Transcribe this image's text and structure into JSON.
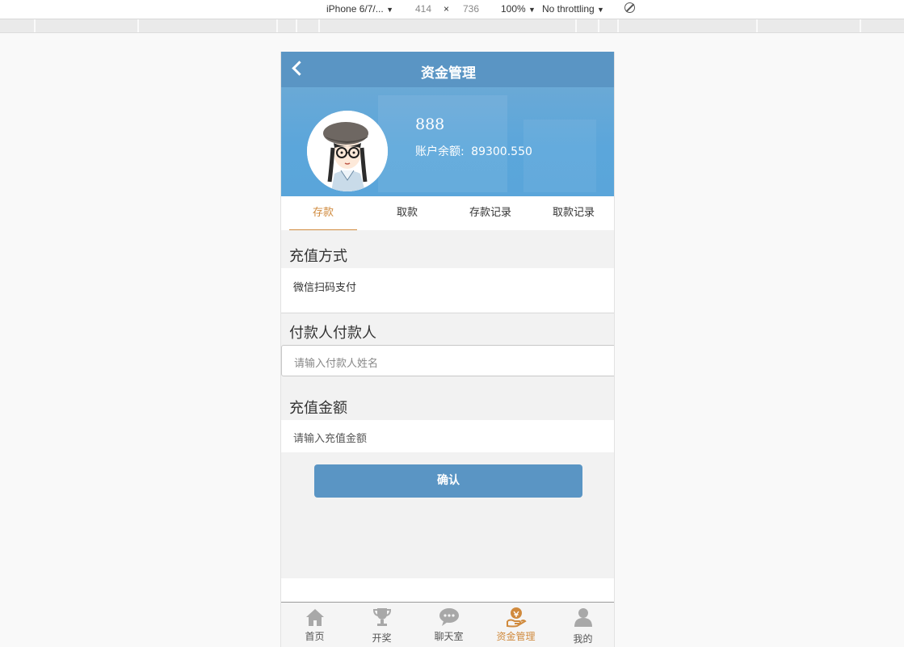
{
  "devtools": {
    "device": "iPhone 6/7/...",
    "width": "414",
    "times": "×",
    "height": "736",
    "zoom": "100%",
    "throttling": "No throttling"
  },
  "nav": {
    "title": "资金管理"
  },
  "profile": {
    "username": "888",
    "balance_label": "账户余额:",
    "balance_value": "89300.550"
  },
  "tabs": [
    {
      "label": "存款",
      "active": true
    },
    {
      "label": "取款",
      "active": false
    },
    {
      "label": "存款记录",
      "active": false
    },
    {
      "label": "取款记录",
      "active": false
    }
  ],
  "form": {
    "method_label": "充值方式",
    "method_value": "微信扫码支付",
    "payer_label": "付款人付款人",
    "payer_placeholder": "请输入付款人姓名",
    "amount_label": "充值金额",
    "amount_placeholder": "请输入充值金额",
    "confirm_label": "确认"
  },
  "tabbar": [
    {
      "label": "首页",
      "icon": "home-icon",
      "active": false
    },
    {
      "label": "开奖",
      "icon": "trophy-icon",
      "active": false
    },
    {
      "label": "聊天室",
      "icon": "chat-icon",
      "active": false
    },
    {
      "label": "资金管理",
      "icon": "money-hand-icon",
      "active": true
    },
    {
      "label": "我的",
      "icon": "user-icon",
      "active": false
    }
  ],
  "colors": {
    "brand_blue": "#5a95c4",
    "accent_orange": "#d08a3d"
  }
}
